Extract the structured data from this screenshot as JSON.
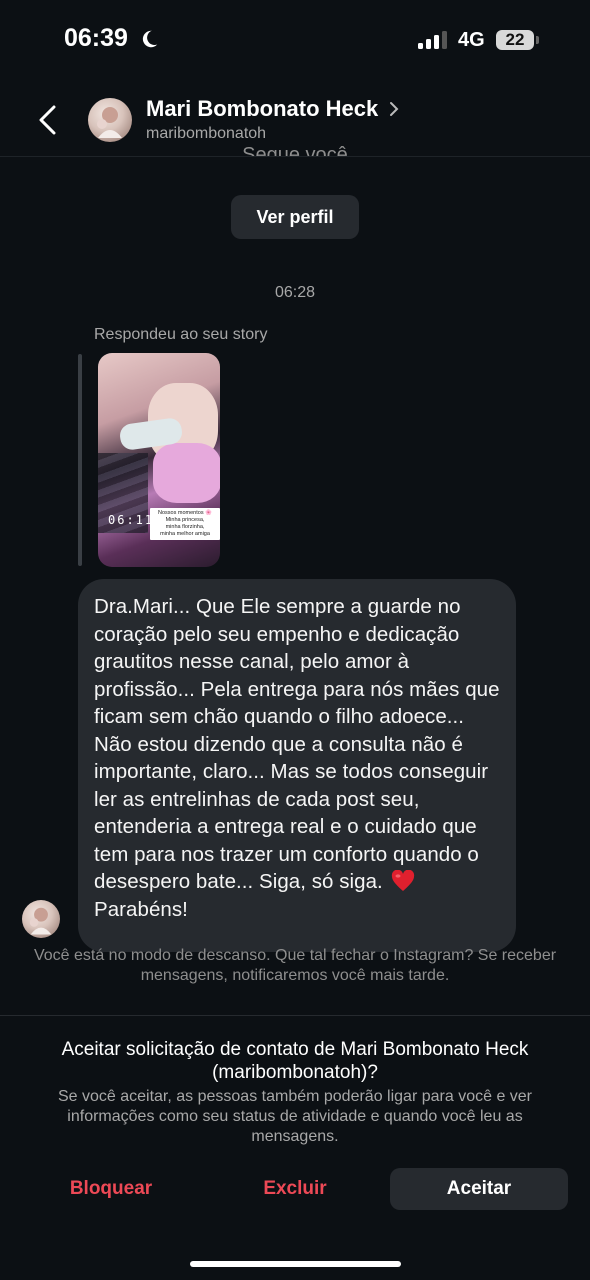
{
  "status_bar": {
    "time": "06:39",
    "network": "4G",
    "battery": "22"
  },
  "header": {
    "name": "Mari Bombonato Heck",
    "username": "maribombonatoh",
    "partial_text": "Segue você"
  },
  "profile_button": "Ver perfil",
  "chat": {
    "timestamp": "06:28",
    "story_reply_label": "Respondeu ao seu story",
    "story": {
      "time_overlay": "06:11",
      "caption_lines": [
        "Nossos momentos 🌸",
        "Minha princesa,",
        "minha florzinha,",
        "minha melhor amiga"
      ]
    },
    "message_text": "Dra.Mari... Que Ele sempre a guarde no coração pelo seu empenho e dedicação grautitos nesse canal, pelo amor à profissão... Pela entrega para nós mães que ficam sem chão quando o filho adoece... Não estou dizendo que a consulta não é importante, claro... Mas se todos conseguir ler as entrelinhas de cada post seu, entenderia a entrega real e o cuidado que tem para nos trazer um conforto quando o desespero bate... Siga, só siga.",
    "message_end": "Parabéns!",
    "heart_emoji": "❤️"
  },
  "rest_mode_note": "Você está no modo de descanso. Que tal fechar o Instagram? Se receber mensagens, notificaremos você mais tarde.",
  "request": {
    "title": "Aceitar solicitação de contato de Mari Bombonato Heck (maribombonatoh)?",
    "body": "Se você aceitar, as pessoas também poderão ligar para você e ver informações como seu status de atividade e quando você leu as mensagens.",
    "block_label": "Bloquear",
    "delete_label": "Excluir",
    "accept_label": "Aceitar"
  },
  "colors": {
    "background": "#0c1014",
    "bubble": "#262a2f",
    "danger": "#ed4956",
    "muted": "#a8a8a8"
  },
  "icons": [
    "moon-icon",
    "signal-icon",
    "battery-icon",
    "back-arrow-icon",
    "chevron-right-icon",
    "heart-emoji"
  ]
}
